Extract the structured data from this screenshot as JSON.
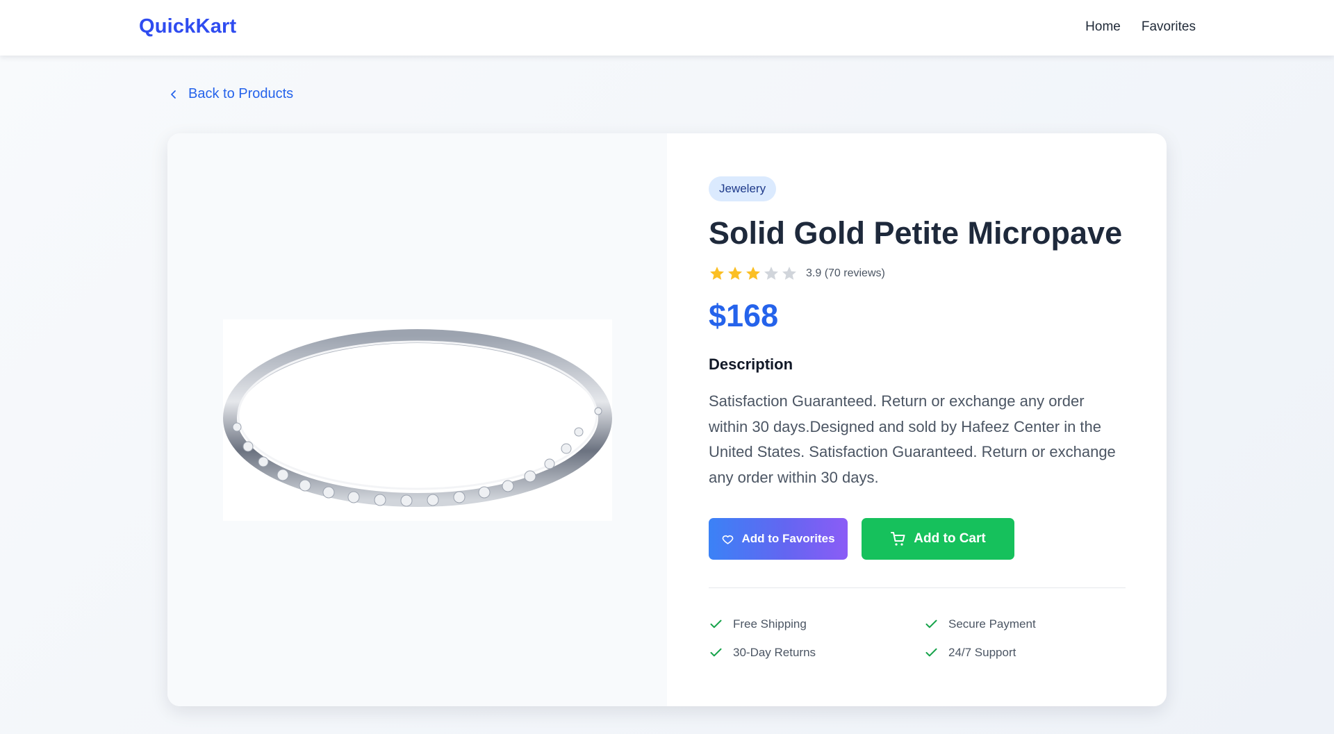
{
  "header": {
    "brand": "QuickKart",
    "nav": [
      {
        "label": "Home"
      },
      {
        "label": "Favorites"
      }
    ]
  },
  "back_link": {
    "label": "Back to Products"
  },
  "product": {
    "category": "Jewelery",
    "title": "Solid Gold Petite Micropave",
    "rating": {
      "value": 3.9,
      "stars_filled": 3,
      "stars_total": 5,
      "text": "3.9 (70 reviews)"
    },
    "price": "$168",
    "description_heading": "Description",
    "description": "Satisfaction Guaranteed. Return or exchange any order within 30 days.Designed and sold by Hafeez Center in the United States. Satisfaction Guaranteed. Return or exchange any order within 30 days.",
    "image_icon": "ring-image"
  },
  "actions": {
    "favorites_label": "Add to Favorites",
    "favorites_icon": "heart-icon",
    "cart_label": "Add to Cart",
    "cart_icon": "cart-icon"
  },
  "features": [
    {
      "label": "Free Shipping",
      "icon": "check-icon"
    },
    {
      "label": "Secure Payment",
      "icon": "check-icon"
    },
    {
      "label": "30-Day Returns",
      "icon": "check-icon"
    },
    {
      "label": "24/7 Support",
      "icon": "check-icon"
    }
  ],
  "colors": {
    "brand": "#2f4cf0",
    "link": "#2563eb",
    "price": "#2563eb",
    "star_filled": "#fbbf24",
    "star_empty": "#d1d5db",
    "cart_button": "#16c15c",
    "check": "#16a34a"
  }
}
